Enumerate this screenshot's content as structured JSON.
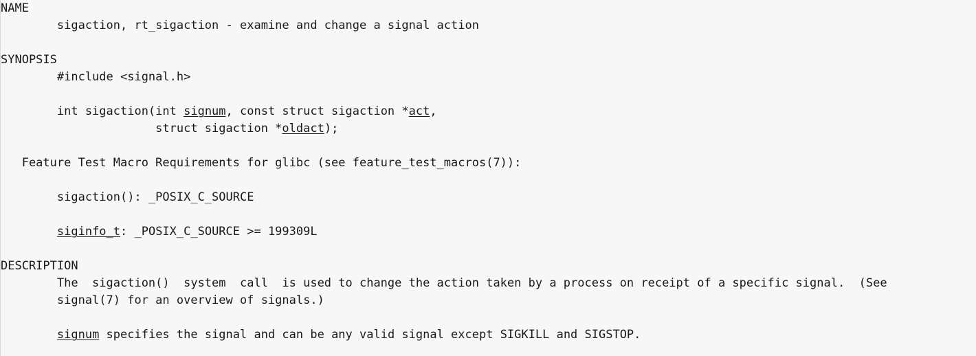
{
  "page": {
    "name": "sigaction",
    "background_color": "#f7f7f7",
    "text_color": "#1a1a1a",
    "border_color": "#d8d8d8"
  },
  "sections": {
    "name_heading": "NAME",
    "synopsis_heading": "SYNOPSIS",
    "description_heading": "DESCRIPTION"
  },
  "lines": {
    "name_body": "        sigaction, rt_sigaction - examine and change a signal action",
    "synopsis_include": "        #include <signal.h>",
    "synopsis_proto_1_pre": "        int sigaction(int ",
    "synopsis_proto_1_it1": "signum",
    "synopsis_proto_1_mid": ", const struct sigaction *",
    "synopsis_proto_1_it2": "act",
    "synopsis_proto_1_post": ",",
    "synopsis_proto_2_pre": "                      struct sigaction *",
    "synopsis_proto_2_it1": "oldact",
    "synopsis_proto_2_post": ");",
    "feature_test_heading": "   Feature Test Macro Requirements for glibc (see feature_test_macros(7)):",
    "feature_sigaction": "        sigaction(): _POSIX_C_SOURCE",
    "feature_siginfo_pre": "        ",
    "feature_siginfo_it": "siginfo_t",
    "feature_siginfo_post": ": _POSIX_C_SOURCE >= 199309L",
    "description_1": "        The  sigaction()  system  call  is used to change the action taken by a process on receipt of a specific signal.  (See",
    "description_2": "        signal(7) for an overview of signals.)",
    "description_3_pre": "        ",
    "description_3_it": "signum",
    "description_3_post": " specifies the signal and can be any valid signal except SIGKILL and SIGSTOP."
  }
}
